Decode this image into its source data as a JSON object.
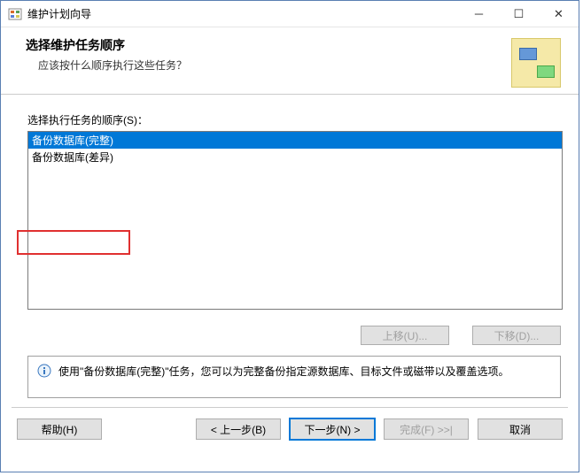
{
  "window": {
    "title": "维护计划向导"
  },
  "header": {
    "title": "选择维护任务顺序",
    "subtitle": "应该按什么顺序执行这些任务？"
  },
  "list": {
    "label": "选择执行任务的顺序(S)：",
    "items": [
      {
        "label": "备份数据库(完整)",
        "selected": true
      },
      {
        "label": "备份数据库(差异)",
        "selected": false
      }
    ]
  },
  "move_buttons": {
    "up": "上移(U)...",
    "down": "下移(D)..."
  },
  "info": {
    "text": "使用\"备份数据库(完整)\"任务，您可以为完整备份指定源数据库、目标文件或磁带以及覆盖选项。"
  },
  "footer": {
    "help": "帮助(H)",
    "back": "< 上一步(B)",
    "next": "下一步(N) >",
    "finish": "完成(F) >>|",
    "cancel": "取消"
  }
}
